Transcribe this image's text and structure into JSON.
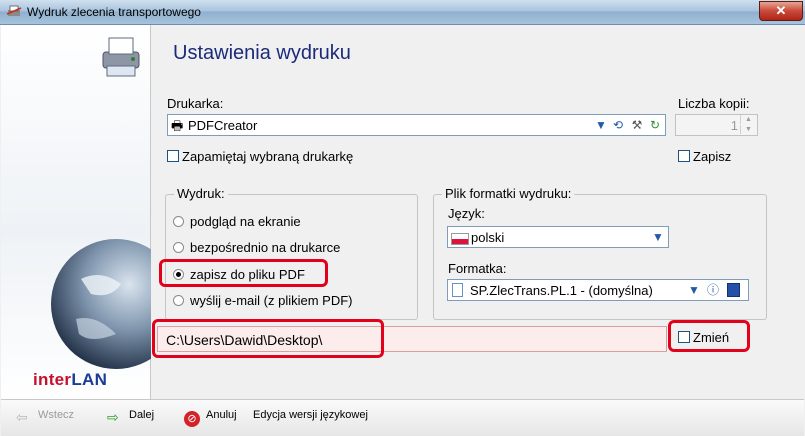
{
  "window": {
    "title": "Wydruk zlecenia transportowego",
    "close_symbol": "✕"
  },
  "header": {
    "title": "Ustawienia wydruku"
  },
  "printer": {
    "label": "Drukarka:",
    "value": "PDFCreator",
    "remember_label": "Zapamiętaj wybraną drukarkę",
    "copies_label": "Liczba kopii:",
    "copies_value": "1",
    "save_label": "Zapisz"
  },
  "print_group": {
    "title": "Wydruk:",
    "options": [
      {
        "label": "podgląd na ekranie",
        "selected": false
      },
      {
        "label": "bezpośrednio na drukarce",
        "selected": false
      },
      {
        "label": "zapisz do pliku PDF",
        "selected": true
      },
      {
        "label": "wyślij e-mail (z plikiem PDF)",
        "selected": false
      }
    ]
  },
  "template_group": {
    "title": "Plik formatki wydruku:",
    "language_label": "Język:",
    "language_value": "polski",
    "template_label": "Formatka:",
    "template_value": "SP.ZlecTrans.PL.1 - (domyślna)"
  },
  "path": {
    "value": "C:\\Users\\Dawid\\Desktop\\",
    "change_label": "Zmień"
  },
  "brand": {
    "part1": "inter",
    "part2": "LAN"
  },
  "footer": {
    "back": "Wstecz",
    "next": "Dalej",
    "cancel": "Anuluj",
    "language_edition": "Edycja wersji językowej"
  },
  "colors": {
    "title_blue": "#1b2b7a",
    "highlight_red": "#e3001b",
    "path_bg": "#fcecec",
    "brand_red": "#c8102e",
    "brand_blue": "#1a3c96"
  }
}
